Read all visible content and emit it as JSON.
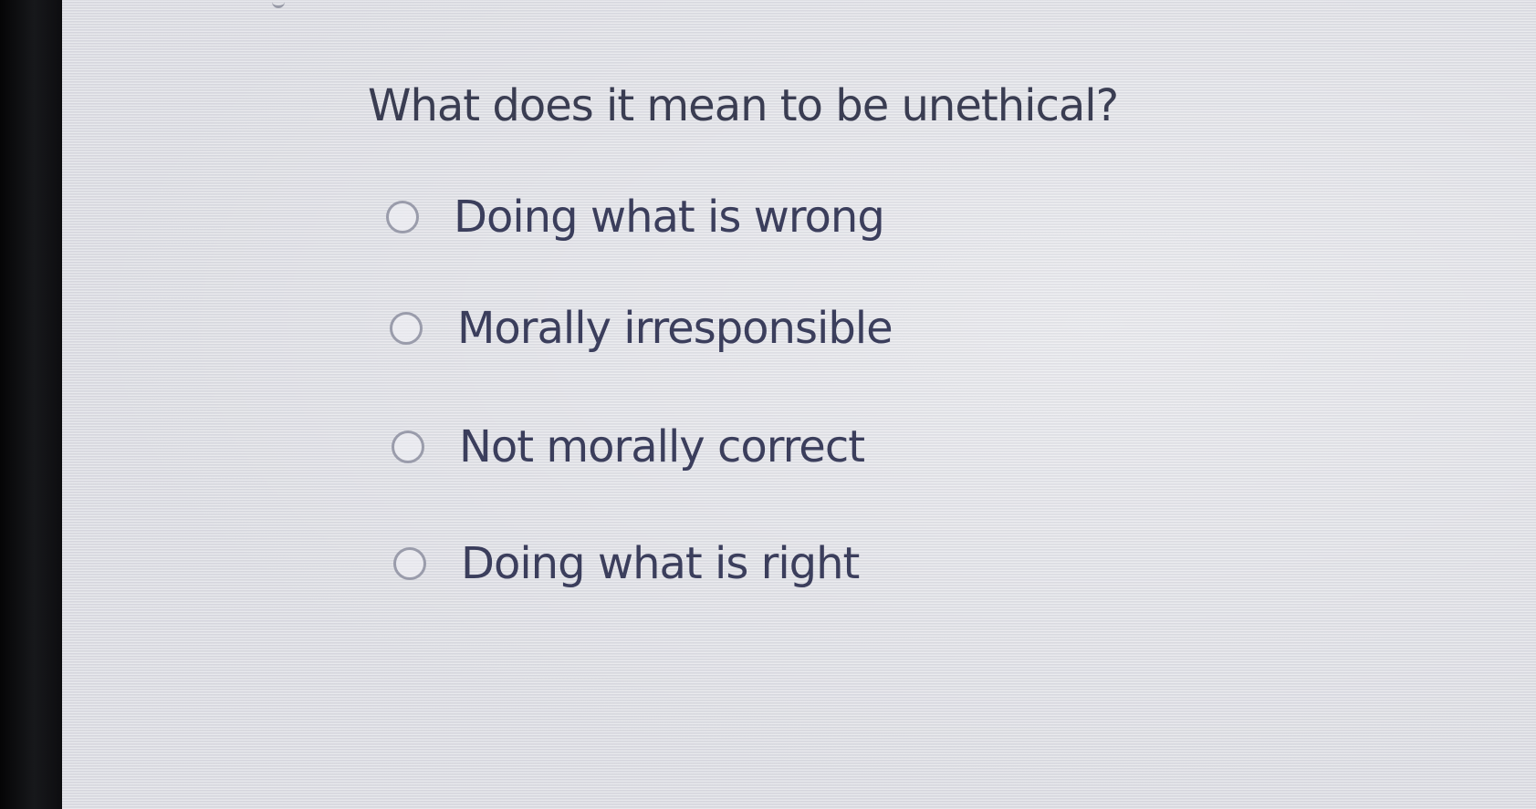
{
  "question": {
    "text": "What does it mean to be unethical?"
  },
  "options": [
    {
      "label": "Doing what is wrong",
      "selected": false
    },
    {
      "label": "Morally irresponsible",
      "selected": false
    },
    {
      "label": "Not morally correct",
      "selected": false
    },
    {
      "label": "Doing what is right",
      "selected": false
    }
  ],
  "icons": {
    "radio": "radio-unchecked-icon"
  },
  "colors": {
    "text": "#3b3e5c",
    "radio_border": "#9a9cab",
    "background": "#dcdde3"
  }
}
